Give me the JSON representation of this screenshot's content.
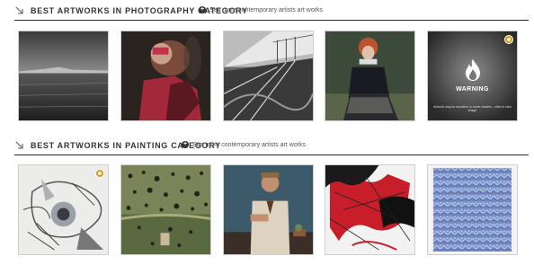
{
  "photography": {
    "title": "BEST ARTWORKS IN PHOTOGRAPHY CATEGORY",
    "more_link": "See more contemporary artists art works",
    "warning": {
      "label": "WARNING",
      "sub": "Artwork may be sensitive to some viewers - click to view image"
    }
  },
  "painting": {
    "title": "BEST ARTWORKS IN PAINTING CATEGORY",
    "more_link": "See more contemporary artists art works"
  },
  "colors": {
    "header_rule": "#2a2a2a",
    "award_badge": "#c89a2a"
  }
}
